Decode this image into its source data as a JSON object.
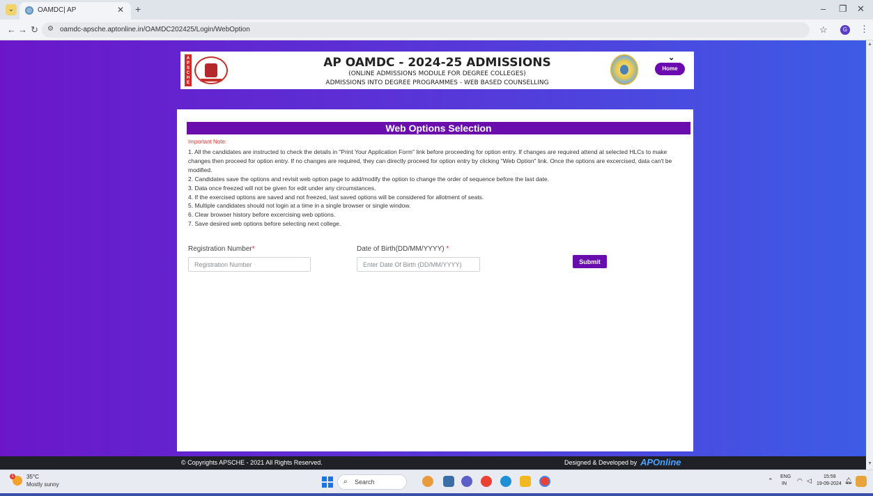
{
  "browser": {
    "tab_title": "OAMDC| AP",
    "url": "oamdc-apsche.aptonline.in/OAMDC202425/Login/WebOption",
    "profile_initial": "G"
  },
  "header": {
    "title": "AP OAMDC - 2024-25 ADMISSIONS",
    "subtitle1": "(ONLINE ADMISSIONS MODULE FOR DEGREE COLLEGES)",
    "subtitle2": "ADMISSIONS INTO DEGREE PROGRAMMES - WEB BASED COUNSELLING",
    "apsche_letters": "APSCHE",
    "home_label": "Home"
  },
  "main": {
    "section_title": "Web Options Selection",
    "note_label": "Important Note:",
    "notes": [
      "1. All the candidates are instructed to check the details in \"Print Your Application Form\" link before proceeding for option entry. If changes are required attend at selected HLCs to make changes then proceed for option entry. If no changes are required, they can directly proceed for option entry by clicking \"Web Option\" link. Once the options are excercised, data can't be modified.",
      "2. Candidates save the options and revisit web option page to add/modify the option to change the order of sequence before the last date.",
      "3. Data once freezed will not be given for edit under any circumstances.",
      "4. If the exercised options are saved and not freezed, last saved options will be considered for allotment of seats.",
      "5. Multiple candidates should not login at a time in a single browser or single window.",
      "6. Clear browser history before excercising web options.",
      "7. Save desired web options before selecting next college."
    ],
    "reg_label": "Registration Number",
    "reg_placeholder": "Registration Number",
    "dob_label": "Date of Birth(DD/MM/YYYY) ",
    "dob_placeholder": "Enter Date Of Birth (DD/MM/YYYY)",
    "required_mark": "*",
    "submit_label": "Submit"
  },
  "footer": {
    "copyright": "© Copyrights APSCHE - 2021 All Rights Reserved.",
    "designed_by": "Designed & Developed by",
    "designer_logo": "APOnline"
  },
  "taskbar": {
    "weather_temp": "35°C",
    "weather_desc": "Mostly sunny",
    "weather_badge": "1",
    "search_text": "Search",
    "lang": "ENG",
    "region": "IN",
    "time": "15:59",
    "date": "19-09-2024"
  }
}
